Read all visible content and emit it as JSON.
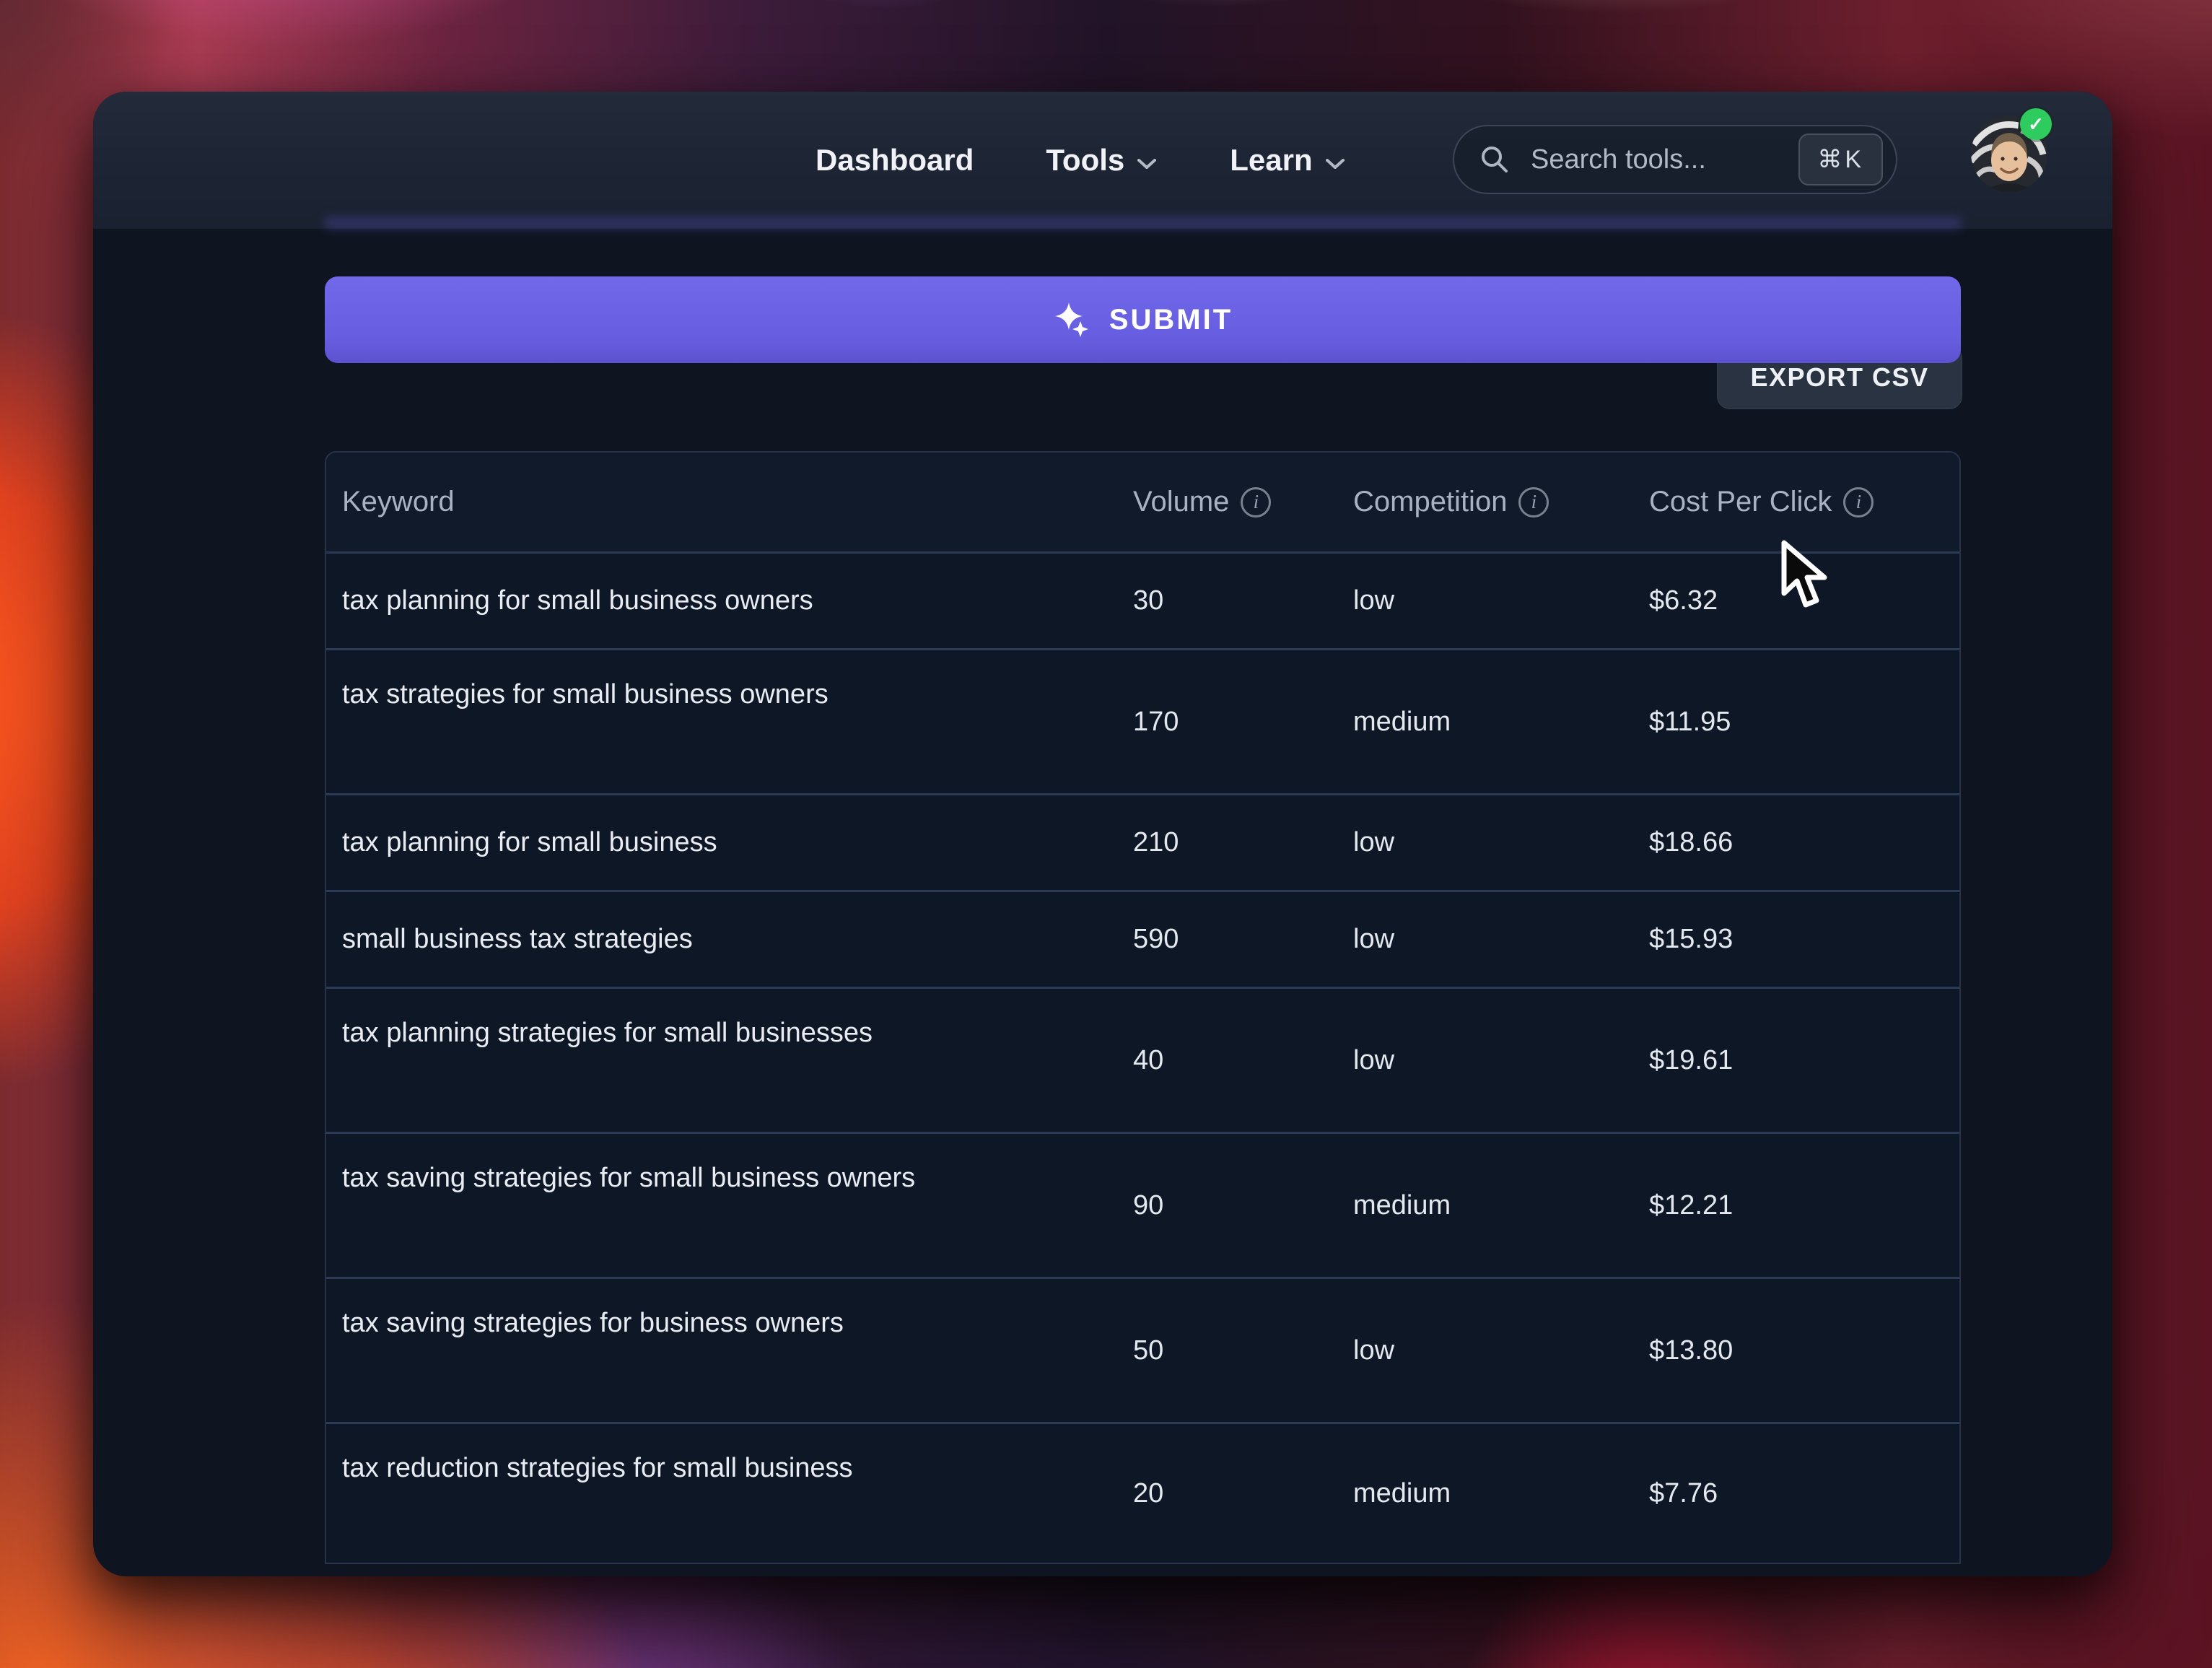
{
  "nav": {
    "items": [
      {
        "label": "Dashboard",
        "has_chevron": false
      },
      {
        "label": "Tools",
        "has_chevron": true
      },
      {
        "label": "Learn",
        "has_chevron": true
      }
    ],
    "search": {
      "placeholder": "Search tools...",
      "shortcut": "⌘K"
    },
    "avatar": {
      "verified": true,
      "badge_check": "✓"
    }
  },
  "submit_button": {
    "label": "SUBMIT"
  },
  "export_button": {
    "label": "EXPORT CSV"
  },
  "table": {
    "columns": [
      {
        "label": "Keyword",
        "info": false
      },
      {
        "label": "Volume",
        "info": true
      },
      {
        "label": "Competition",
        "info": true
      },
      {
        "label": "Cost Per Click",
        "info": true
      }
    ],
    "rows": [
      {
        "keyword": "tax planning for small business owners",
        "volume": "30",
        "competition": "low",
        "cpc": "$6.32",
        "tall": false
      },
      {
        "keyword": "tax strategies for small business owners",
        "volume": "170",
        "competition": "medium",
        "cpc": "$11.95",
        "tall": true
      },
      {
        "keyword": "tax planning for small business",
        "volume": "210",
        "competition": "low",
        "cpc": "$18.66",
        "tall": false
      },
      {
        "keyword": "small business tax strategies",
        "volume": "590",
        "competition": "low",
        "cpc": "$15.93",
        "tall": false
      },
      {
        "keyword": "tax planning strategies for small businesses",
        "volume": "40",
        "competition": "low",
        "cpc": "$19.61",
        "tall": true
      },
      {
        "keyword": "tax saving strategies for small business owners",
        "volume": "90",
        "competition": "medium",
        "cpc": "$12.21",
        "tall": true
      },
      {
        "keyword": "tax saving strategies for business owners",
        "volume": "50",
        "competition": "low",
        "cpc": "$13.80",
        "tall": true
      },
      {
        "keyword": "tax reduction strategies for small business",
        "volume": "20",
        "competition": "medium",
        "cpc": "$7.76",
        "tall": true
      }
    ]
  },
  "colors": {
    "accent_purple": "#6b62e2",
    "verified_green": "#2ecc5e",
    "window_bg": "#0e1520",
    "table_border": "#26334b"
  }
}
